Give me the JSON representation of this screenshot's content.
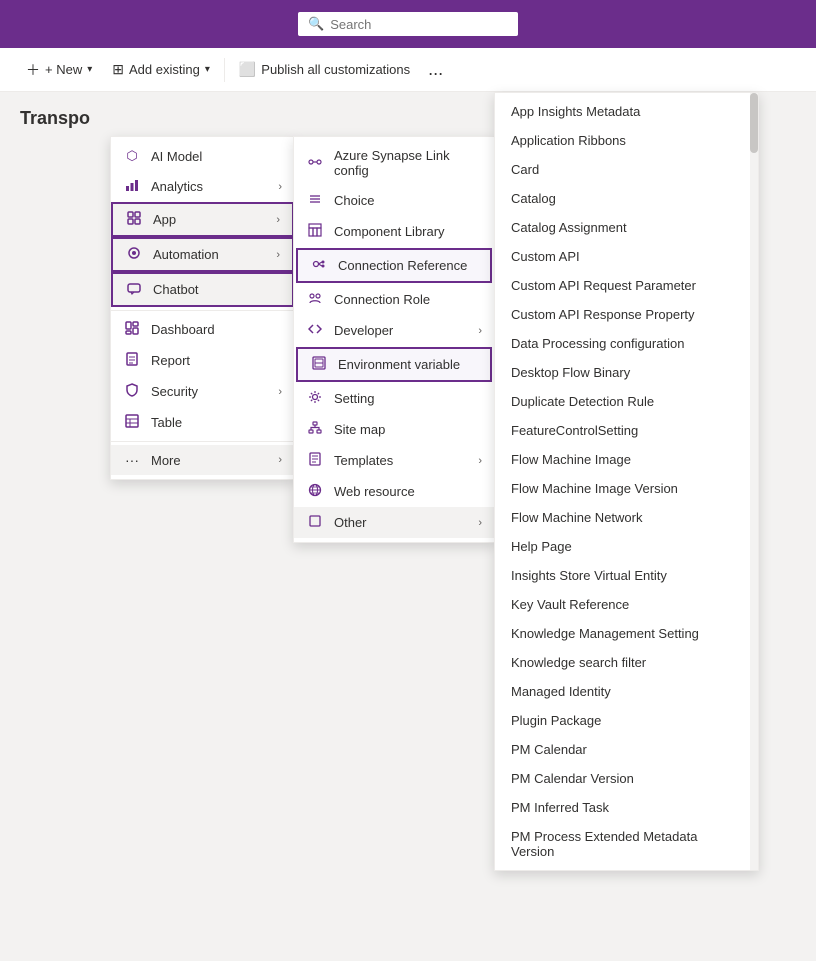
{
  "header": {
    "search_placeholder": "Search"
  },
  "toolbar": {
    "new_label": "+ New",
    "add_existing_label": "Add existing",
    "publish_label": "Publish all customizations",
    "more_label": "..."
  },
  "page": {
    "title": "Transpo"
  },
  "menu_l1": {
    "items": [
      {
        "id": "ai-model",
        "icon": "⬜",
        "label": "AI Model",
        "has_chevron": false
      },
      {
        "id": "analytics",
        "icon": "📊",
        "label": "Analytics",
        "has_chevron": true
      },
      {
        "id": "app",
        "icon": "📱",
        "label": "App",
        "has_chevron": true,
        "active": true
      },
      {
        "id": "automation",
        "icon": "⚙",
        "label": "Automation",
        "has_chevron": true,
        "active": true
      },
      {
        "id": "chatbot",
        "icon": "🤖",
        "label": "Chatbot",
        "active": true
      },
      {
        "id": "dashboard",
        "icon": "📊",
        "label": "Dashboard",
        "has_chevron": false
      },
      {
        "id": "report",
        "icon": "📄",
        "label": "Report",
        "has_chevron": false
      },
      {
        "id": "security",
        "icon": "🛡",
        "label": "Security",
        "has_chevron": true
      },
      {
        "id": "table",
        "icon": "▦",
        "label": "Table",
        "has_chevron": false
      },
      {
        "id": "more",
        "icon": "",
        "label": "More",
        "has_chevron": true,
        "selected": true
      }
    ]
  },
  "menu_l2": {
    "items": [
      {
        "id": "azure-synapse",
        "icon": "🔗",
        "label": "Azure Synapse Link config",
        "has_chevron": false
      },
      {
        "id": "choice",
        "icon": "≡",
        "label": "Choice",
        "has_chevron": false
      },
      {
        "id": "component-library",
        "icon": "▦",
        "label": "Component Library",
        "has_chevron": false
      },
      {
        "id": "connection-reference",
        "icon": "🔌",
        "label": "Connection Reference",
        "has_chevron": false,
        "highlighted": true
      },
      {
        "id": "connection-role",
        "icon": "👥",
        "label": "Connection Role",
        "has_chevron": false
      },
      {
        "id": "developer",
        "icon": "🔧",
        "label": "Developer",
        "has_chevron": true
      },
      {
        "id": "environment-variable",
        "icon": "▦",
        "label": "Environment variable",
        "has_chevron": false,
        "highlighted": true
      },
      {
        "id": "setting",
        "icon": "⚙",
        "label": "Setting",
        "has_chevron": false
      },
      {
        "id": "site-map",
        "icon": "🗺",
        "label": "Site map",
        "has_chevron": false
      },
      {
        "id": "templates",
        "icon": "📄",
        "label": "Templates",
        "has_chevron": true
      },
      {
        "id": "web-resource",
        "icon": "🌐",
        "label": "Web resource",
        "has_chevron": false
      },
      {
        "id": "other",
        "icon": "◻",
        "label": "Other",
        "has_chevron": true,
        "selected": true
      }
    ]
  },
  "menu_l3": {
    "items": [
      {
        "id": "app-insights",
        "label": "App Insights Metadata"
      },
      {
        "id": "app-ribbons",
        "label": "Application Ribbons"
      },
      {
        "id": "card",
        "label": "Card"
      },
      {
        "id": "catalog",
        "label": "Catalog"
      },
      {
        "id": "catalog-assignment",
        "label": "Catalog Assignment"
      },
      {
        "id": "custom-api",
        "label": "Custom API"
      },
      {
        "id": "custom-api-request",
        "label": "Custom API Request Parameter"
      },
      {
        "id": "custom-api-response",
        "label": "Custom API Response Property"
      },
      {
        "id": "data-processing",
        "label": "Data Processing configuration"
      },
      {
        "id": "desktop-flow-binary",
        "label": "Desktop Flow Binary"
      },
      {
        "id": "duplicate-detection",
        "label": "Duplicate Detection Rule"
      },
      {
        "id": "feature-control",
        "label": "FeatureControlSetting"
      },
      {
        "id": "flow-machine-image",
        "label": "Flow Machine Image"
      },
      {
        "id": "flow-machine-image-version",
        "label": "Flow Machine Image Version"
      },
      {
        "id": "flow-machine-network",
        "label": "Flow Machine Network"
      },
      {
        "id": "help-page",
        "label": "Help Page"
      },
      {
        "id": "insights-store",
        "label": "Insights Store Virtual Entity"
      },
      {
        "id": "key-vault",
        "label": "Key Vault Reference"
      },
      {
        "id": "knowledge-management",
        "label": "Knowledge Management Setting"
      },
      {
        "id": "knowledge-search",
        "label": "Knowledge search filter"
      },
      {
        "id": "managed-identity",
        "label": "Managed Identity"
      },
      {
        "id": "plugin-package",
        "label": "Plugin Package"
      },
      {
        "id": "pm-calendar",
        "label": "PM Calendar"
      },
      {
        "id": "pm-calendar-version",
        "label": "PM Calendar Version"
      },
      {
        "id": "pm-inferred-task",
        "label": "PM Inferred Task"
      },
      {
        "id": "pm-process-extended",
        "label": "PM Process Extended Metadata Version"
      }
    ]
  }
}
